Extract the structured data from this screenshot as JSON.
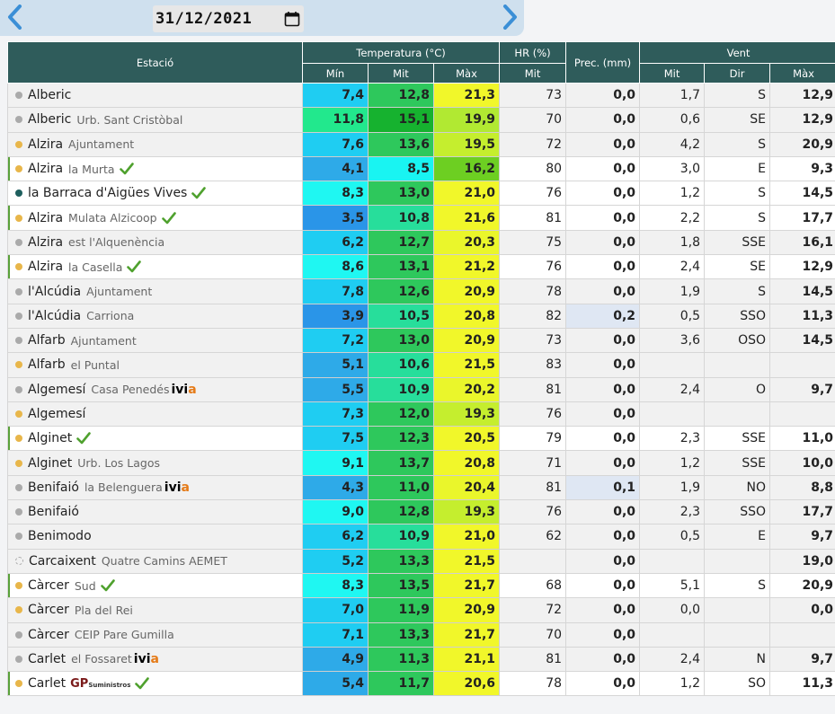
{
  "nav": {
    "prev_icon": "chevron-left-icon",
    "next_icon": "chevron-right-icon",
    "date_value": "31/12/2021",
    "calendar_icon": "calendar-icon"
  },
  "colors": {
    "header_bg": "#2f5c5b",
    "dot_gray": "#aaaaaa",
    "dot_orange": "#e8b64a",
    "dot_teal": "#1e5f5e",
    "check_green": "#4fa12e"
  },
  "table": {
    "headers": {
      "station": "Estació",
      "temperature": "Temperatura (°C)",
      "humidity": "HR (%)",
      "precipitation": "Prec. (mm)",
      "wind": "Vent",
      "t_min": "Mín",
      "t_mit": "Mit",
      "t_max": "Màx",
      "hr_mit": "Mit",
      "w_mit": "Mit",
      "w_dir": "Dir",
      "w_max": "Màx"
    },
    "rows": [
      {
        "name": "Alberic",
        "sub": "",
        "dot": "gray",
        "check": false,
        "bar": false,
        "logo": "",
        "min": "7,4",
        "mit": "12,8",
        "max": "21,3",
        "hr": "73",
        "prec": "0,0",
        "wmit": "1,7",
        "dir": "S",
        "wmax": "12,9",
        "cmin": "#1fcdf2",
        "cmit": "#2ec85c",
        "cmax": "#f1f72a"
      },
      {
        "name": "Alberic",
        "sub": "Urb. Sant Cristòbal",
        "dot": "gray",
        "check": false,
        "bar": false,
        "logo": "",
        "min": "11,8",
        "mit": "15,1",
        "max": "19,9",
        "hr": "70",
        "prec": "0,0",
        "wmit": "0,6",
        "dir": "SE",
        "wmax": "12,9",
        "cmin": "#22e88d",
        "cmit": "#16b22f",
        "cmax": "#b1e932"
      },
      {
        "name": "Alzira",
        "sub": "Ajuntament",
        "dot": "orange",
        "check": false,
        "bar": false,
        "logo": "",
        "min": "7,6",
        "mit": "13,6",
        "max": "19,5",
        "hr": "72",
        "prec": "0,0",
        "wmit": "4,2",
        "dir": "S",
        "wmax": "20,9",
        "cmin": "#1fcdf2",
        "cmit": "#2ec85c",
        "cmax": "#c5ee2e"
      },
      {
        "name": "Alzira",
        "sub": "la Murta",
        "dot": "orange",
        "check": true,
        "bar": true,
        "logo": "",
        "min": "4,1",
        "mit": "8,5",
        "max": "16,2",
        "hr": "80",
        "prec": "0,0",
        "wmit": "3,0",
        "dir": "E",
        "wmax": "9,3",
        "cmin": "#2eaae8",
        "cmit": "#19f4f2",
        "cmax": "#6dcf22"
      },
      {
        "name": "la Barraca d'Aigües Vives",
        "sub": "",
        "dot": "teal",
        "check": true,
        "bar": false,
        "logo": "",
        "min": "8,3",
        "mit": "13,0",
        "max": "21,0",
        "hr": "76",
        "prec": "0,0",
        "wmit": "1,2",
        "dir": "S",
        "wmax": "14,5",
        "cmin": "#1ff7f2",
        "cmit": "#2ec85c",
        "cmax": "#f1f72a"
      },
      {
        "name": "Alzira",
        "sub": "Mulata Alzicoop",
        "dot": "orange",
        "check": true,
        "bar": true,
        "logo": "",
        "min": "3,5",
        "mit": "10,8",
        "max": "21,6",
        "hr": "81",
        "prec": "0,0",
        "wmit": "2,2",
        "dir": "S",
        "wmax": "17,7",
        "cmin": "#2a95e8",
        "cmit": "#27de9b",
        "cmax": "#f1f72a"
      },
      {
        "name": "Alzira",
        "sub": "est l'Alquenència",
        "dot": "gray",
        "check": false,
        "bar": false,
        "logo": "",
        "min": "6,2",
        "mit": "12,7",
        "max": "20,3",
        "hr": "75",
        "prec": "0,0",
        "wmit": "1,8",
        "dir": "SSE",
        "wmax": "16,1",
        "cmin": "#1fcdf2",
        "cmit": "#2ec85c",
        "cmax": "#eaf62b"
      },
      {
        "name": "Alzira",
        "sub": "la Casella",
        "dot": "orange",
        "check": true,
        "bar": true,
        "logo": "",
        "min": "8,6",
        "mit": "13,1",
        "max": "21,2",
        "hr": "76",
        "prec": "0,0",
        "wmit": "2,4",
        "dir": "SE",
        "wmax": "12,9",
        "cmin": "#1ff7f2",
        "cmit": "#2ec85c",
        "cmax": "#f1f72a"
      },
      {
        "name": "l'Alcúdia",
        "sub": "Ajuntament",
        "dot": "gray",
        "check": false,
        "bar": false,
        "logo": "",
        "min": "7,8",
        "mit": "12,6",
        "max": "20,9",
        "hr": "78",
        "prec": "0,0",
        "wmit": "1,9",
        "dir": "S",
        "wmax": "14,5",
        "cmin": "#1fcdf2",
        "cmit": "#2ec85c",
        "cmax": "#f1f72a"
      },
      {
        "name": "l'Alcúdia",
        "sub": "Carriona",
        "dot": "gray",
        "check": false,
        "bar": false,
        "logo": "",
        "min": "3,9",
        "mit": "10,5",
        "max": "20,8",
        "hr": "82",
        "prec": "0,2",
        "wmit": "0,5",
        "dir": "SSO",
        "wmax": "11,3",
        "cmin": "#2a95e8",
        "cmit": "#27de9b",
        "cmax": "#f1f72a"
      },
      {
        "name": "Alfarb",
        "sub": "Ajuntament",
        "dot": "gray",
        "check": false,
        "bar": false,
        "logo": "",
        "min": "7,2",
        "mit": "13,0",
        "max": "20,9",
        "hr": "73",
        "prec": "0,0",
        "wmit": "3,6",
        "dir": "OSO",
        "wmax": "14,5",
        "cmin": "#1fcdf2",
        "cmit": "#2ec85c",
        "cmax": "#f1f72a"
      },
      {
        "name": "Alfarb",
        "sub": "el Puntal",
        "dot": "orange",
        "check": false,
        "bar": false,
        "logo": "",
        "min": "5,1",
        "mit": "10,6",
        "max": "21,5",
        "hr": "83",
        "prec": "0,0",
        "wmit": "",
        "dir": "",
        "wmax": "",
        "cmin": "#2eaae8",
        "cmit": "#27de9b",
        "cmax": "#f1f72a"
      },
      {
        "name": "Algemesí",
        "sub": "Casa Penedés",
        "dot": "gray",
        "check": false,
        "bar": false,
        "logo": "ivia",
        "min": "5,5",
        "mit": "10,9",
        "max": "20,2",
        "hr": "81",
        "prec": "0,0",
        "wmit": "2,4",
        "dir": "O",
        "wmax": "9,7",
        "cmin": "#2eaae8",
        "cmit": "#27de9b",
        "cmax": "#eaf62b"
      },
      {
        "name": "Algemesí",
        "sub": "",
        "dot": "orange",
        "check": false,
        "bar": false,
        "logo": "",
        "min": "7,3",
        "mit": "12,0",
        "max": "19,3",
        "hr": "76",
        "prec": "0,0",
        "wmit": "",
        "dir": "",
        "wmax": "",
        "cmin": "#1fcdf2",
        "cmit": "#2ec85c",
        "cmax": "#c5ee2e"
      },
      {
        "name": "Alginet",
        "sub": "",
        "dot": "orange",
        "check": true,
        "bar": true,
        "logo": "",
        "min": "7,5",
        "mit": "12,3",
        "max": "20,5",
        "hr": "79",
        "prec": "0,0",
        "wmit": "2,3",
        "dir": "SSE",
        "wmax": "11,0",
        "cmin": "#1fcdf2",
        "cmit": "#2ec85c",
        "cmax": "#f1f72a"
      },
      {
        "name": "Alginet",
        "sub": "Urb. Los Lagos",
        "dot": "orange",
        "check": false,
        "bar": false,
        "logo": "",
        "min": "9,1",
        "mit": "13,7",
        "max": "20,8",
        "hr": "71",
        "prec": "0,0",
        "wmit": "1,2",
        "dir": "SSE",
        "wmax": "10,0",
        "cmin": "#1ff7f2",
        "cmit": "#2ec85c",
        "cmax": "#f1f72a"
      },
      {
        "name": "Benifaió",
        "sub": "la Belenguera",
        "dot": "gray",
        "check": false,
        "bar": false,
        "logo": "ivia",
        "min": "4,3",
        "mit": "11,0",
        "max": "20,4",
        "hr": "81",
        "prec": "0,1",
        "wmit": "1,9",
        "dir": "NO",
        "wmax": "8,8",
        "cmin": "#2eaae8",
        "cmit": "#2ec85c",
        "cmax": "#eaf62b"
      },
      {
        "name": "Benifaió",
        "sub": "",
        "dot": "gray",
        "check": false,
        "bar": false,
        "logo": "",
        "min": "9,0",
        "mit": "12,8",
        "max": "19,3",
        "hr": "76",
        "prec": "0,0",
        "wmit": "2,3",
        "dir": "SSO",
        "wmax": "17,7",
        "cmin": "#1ff7f2",
        "cmit": "#2ec85c",
        "cmax": "#c5ee2e"
      },
      {
        "name": "Benimodo",
        "sub": "",
        "dot": "gray",
        "check": false,
        "bar": false,
        "logo": "",
        "min": "6,2",
        "mit": "10,9",
        "max": "21,0",
        "hr": "62",
        "prec": "0,0",
        "wmit": "0,5",
        "dir": "E",
        "wmax": "9,7",
        "cmin": "#1fcdf2",
        "cmit": "#27de9b",
        "cmax": "#f1f72a"
      },
      {
        "name": "Carcaixent",
        "sub": "Quatre Camins AEMET",
        "dot": "hollow",
        "check": false,
        "bar": false,
        "logo": "",
        "min": "5,2",
        "mit": "13,3",
        "max": "21,5",
        "hr": "",
        "prec": "0,0",
        "wmit": "",
        "dir": "",
        "wmax": "19,0",
        "cmin": "#1fcdf2",
        "cmit": "#2ec85c",
        "cmax": "#f1f72a"
      },
      {
        "name": "Càrcer",
        "sub": "Sud",
        "dot": "orange",
        "check": true,
        "bar": true,
        "logo": "",
        "min": "8,3",
        "mit": "13,5",
        "max": "21,7",
        "hr": "68",
        "prec": "0,0",
        "wmit": "5,1",
        "dir": "S",
        "wmax": "20,9",
        "cmin": "#1ff7f2",
        "cmit": "#2ec85c",
        "cmax": "#f1f72a"
      },
      {
        "name": "Càrcer",
        "sub": "Pla del Rei",
        "dot": "orange",
        "check": false,
        "bar": false,
        "logo": "",
        "min": "7,0",
        "mit": "11,9",
        "max": "20,9",
        "hr": "72",
        "prec": "0,0",
        "wmit": "0,0",
        "dir": "",
        "wmax": "0,0",
        "cmin": "#1fcdf2",
        "cmit": "#2ec85c",
        "cmax": "#f1f72a"
      },
      {
        "name": "Càrcer",
        "sub": "CEIP Pare Gumilla",
        "dot": "gray",
        "check": false,
        "bar": false,
        "logo": "",
        "min": "7,1",
        "mit": "13,3",
        "max": "21,7",
        "hr": "70",
        "prec": "0,0",
        "wmit": "",
        "dir": "",
        "wmax": "",
        "cmin": "#1fcdf2",
        "cmit": "#2ec85c",
        "cmax": "#f1f72a"
      },
      {
        "name": "Carlet",
        "sub": "el Fossaret",
        "dot": "gray",
        "check": false,
        "bar": false,
        "logo": "ivia",
        "min": "4,9",
        "mit": "11,3",
        "max": "21,1",
        "hr": "81",
        "prec": "0,0",
        "wmit": "2,4",
        "dir": "N",
        "wmax": "9,7",
        "cmin": "#2eaae8",
        "cmit": "#2ec85c",
        "cmax": "#f1f72a"
      },
      {
        "name": "Carlet",
        "sub": "",
        "dot": "orange",
        "check": true,
        "bar": true,
        "logo": "gp",
        "min": "5,4",
        "mit": "11,7",
        "max": "20,6",
        "hr": "78",
        "prec": "0,0",
        "wmit": "1,2",
        "dir": "SO",
        "wmax": "11,3",
        "cmin": "#2eaae8",
        "cmit": "#2ec85c",
        "cmax": "#f1f72a"
      }
    ]
  }
}
